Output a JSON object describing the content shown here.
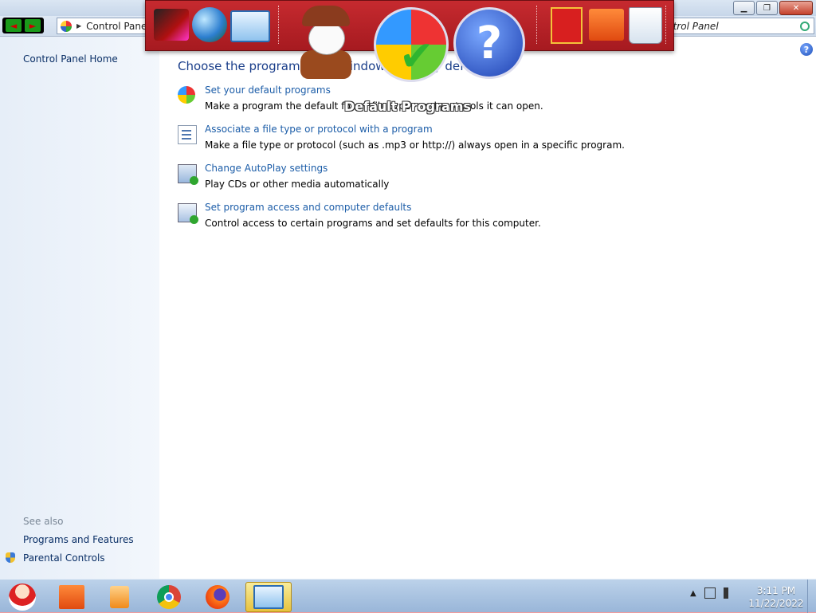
{
  "window": {
    "minimize": "▁",
    "maximize": "❐",
    "close": "✕"
  },
  "navbar": {
    "back": "◄",
    "forward": "►",
    "address_crumb": "Control Panel",
    "search_text": "ntrol Panel"
  },
  "dock": {
    "items": [
      "pictures-icon",
      "globe-icon",
      "control-panel-icon",
      "snowman-icon",
      "default-programs-icon",
      "help-icon",
      "gift-icon",
      "folder-icon",
      "recycle-bin-icon"
    ],
    "hover_label": "Default Programs",
    "help_glyph": "?",
    "check_glyph": "✔"
  },
  "sidebar": {
    "home": "Control Panel Home",
    "see_also": "See also",
    "links": [
      "Programs and Features",
      "Parental Controls"
    ]
  },
  "main": {
    "help_glyph": "?",
    "heading": "Choose the programs that Windows uses by default",
    "entries": [
      {
        "link": "Set your default programs",
        "desc": "Make a program the default for all file types and protocols it can open.",
        "icon": "default-programs-icon"
      },
      {
        "link": "Associate a file type or protocol with a program",
        "desc": "Make a file type or protocol (such as .mp3 or http://) always open in a specific program.",
        "icon": "file-association-icon"
      },
      {
        "link": "Change AutoPlay settings",
        "desc": "Play CDs or other media automatically",
        "icon": "autoplay-icon"
      },
      {
        "link": "Set program access and computer defaults",
        "desc": "Control access to certain programs and set defaults for this computer.",
        "icon": "program-access-icon"
      }
    ]
  },
  "taskbar": {
    "items": [
      "start-button",
      "explorer-folder-icon",
      "media-player-icon",
      "chrome-icon",
      "firefox-icon",
      "control-panel-icon"
    ],
    "tray_arrow": "▲",
    "time": "3:11 PM",
    "date": "11/22/2022"
  },
  "colors": {
    "dock": "#b82227",
    "link": "#1c5da8",
    "heading": "#1a3e8a"
  }
}
